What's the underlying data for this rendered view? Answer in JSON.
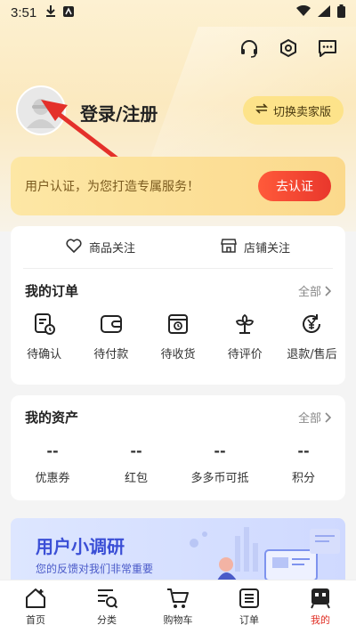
{
  "status_bar": {
    "time": "3:51"
  },
  "header": {
    "icons": [
      "headset-icon",
      "settings-hexagon-icon",
      "message-icon"
    ]
  },
  "profile": {
    "login_label": "登录/注册",
    "switch_label": "切换卖家版"
  },
  "verify_banner": {
    "text": "用户认证，为您打造专属服务！",
    "button_label": "去认证"
  },
  "follow": {
    "items": [
      {
        "label": "商品关注",
        "icon": "heart-icon"
      },
      {
        "label": "店铺关注",
        "icon": "store-icon"
      }
    ]
  },
  "orders": {
    "title": "我的订单",
    "more": "全部",
    "items": [
      {
        "label": "待确认",
        "icon": "pending-confirm-icon"
      },
      {
        "label": "待付款",
        "icon": "wallet-icon"
      },
      {
        "label": "待收货",
        "icon": "delivery-box-icon"
      },
      {
        "label": "待评价",
        "icon": "review-flower-icon"
      },
      {
        "label": "退款/售后",
        "icon": "refund-icon"
      }
    ]
  },
  "assets": {
    "title": "我的资产",
    "more": "全部",
    "items": [
      {
        "value": "--",
        "label": "优惠券"
      },
      {
        "value": "--",
        "label": "红包"
      },
      {
        "value": "--",
        "label": "多多币可抵"
      },
      {
        "value": "--",
        "label": "积分"
      }
    ]
  },
  "survey": {
    "title": "用户小调研",
    "subtitle": "您的反馈对我们非常重要"
  },
  "bottom_nav": {
    "items": [
      {
        "label": "首页",
        "icon": "home-icon"
      },
      {
        "label": "分类",
        "icon": "category-icon"
      },
      {
        "label": "购物车",
        "icon": "cart-icon"
      },
      {
        "label": "订单",
        "icon": "orders-icon"
      },
      {
        "label": "我的",
        "icon": "mine-icon",
        "active": true
      }
    ]
  },
  "colors": {
    "accent_red": "#e02e24",
    "banner_yellow": "#fbd98c",
    "switch_yellow": "#fde38a"
  }
}
